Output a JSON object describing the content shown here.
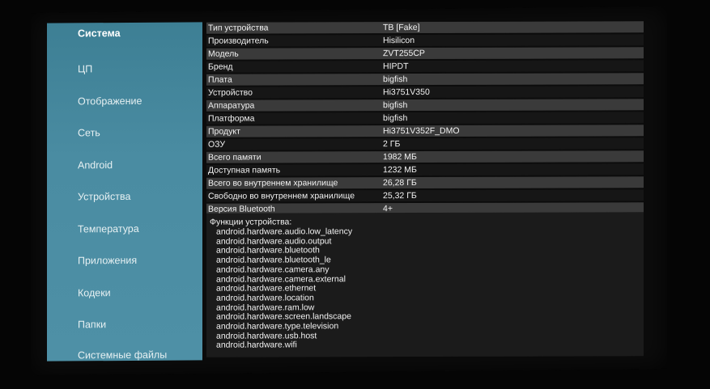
{
  "sidebar": {
    "items": [
      {
        "label": "Система"
      },
      {
        "label": "ЦП"
      },
      {
        "label": "Отображение"
      },
      {
        "label": "Сеть"
      },
      {
        "label": "Android"
      },
      {
        "label": "Устройства"
      },
      {
        "label": "Температура"
      },
      {
        "label": "Приложения"
      },
      {
        "label": "Кодеки"
      },
      {
        "label": "Папки"
      },
      {
        "label": "Системные файлы"
      }
    ]
  },
  "info": {
    "rows": [
      {
        "key": "Тип устройства",
        "value": "ТВ [Fake]"
      },
      {
        "key": "Производитель",
        "value": "Hisilicon"
      },
      {
        "key": "Модель",
        "value": "ZVT255CP"
      },
      {
        "key": "Бренд",
        "value": "HIPDT"
      },
      {
        "key": "Плата",
        "value": "bigfish"
      },
      {
        "key": "Устройство",
        "value": "Hi3751V350"
      },
      {
        "key": "Аппаратура",
        "value": "bigfish"
      },
      {
        "key": "Платформа",
        "value": "bigfish"
      },
      {
        "key": "Продукт",
        "value": "Hi3751V352F_DMO"
      },
      {
        "key": "ОЗУ",
        "value": "2 ГБ"
      },
      {
        "key": "Всего памяти",
        "value": "1982 МБ"
      },
      {
        "key": "Доступная память",
        "value": "1232 МБ"
      },
      {
        "key": "Всего во внутреннем хранилище",
        "value": "26,28 ГБ"
      },
      {
        "key": "Свободно во внутреннем хранилище",
        "value": "25,32 ГБ"
      },
      {
        "key": "Версия Bluetooth",
        "value": "4+"
      }
    ]
  },
  "features": {
    "title": "Функции устройства:",
    "items": [
      "android.hardware.audio.low_latency",
      "android.hardware.audio.output",
      "android.hardware.bluetooth",
      "android.hardware.bluetooth_le",
      "android.hardware.camera.any",
      "android.hardware.camera.external",
      "android.hardware.ethernet",
      "android.hardware.location",
      "android.hardware.ram.low",
      "android.hardware.screen.landscape",
      "android.hardware.type.television",
      "android.hardware.usb.host",
      "android.hardware.wifi"
    ]
  }
}
